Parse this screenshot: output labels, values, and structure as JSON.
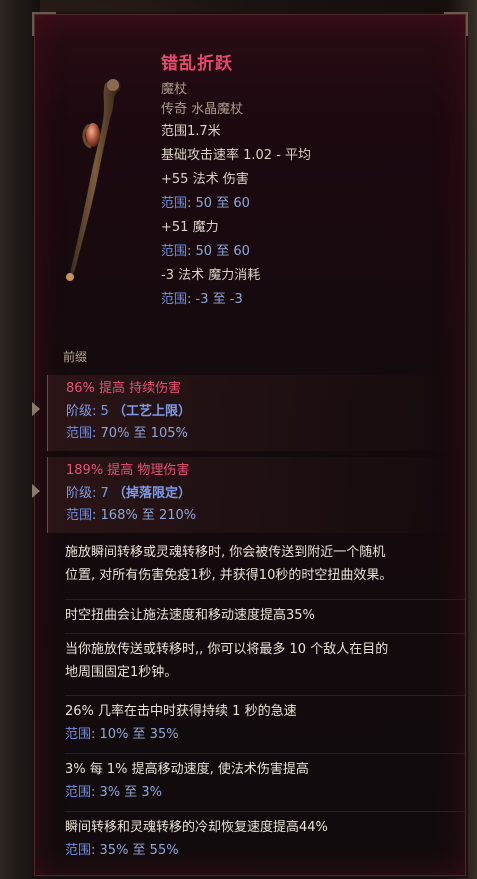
{
  "item": {
    "name": "错乱折跃",
    "base": "魔杖",
    "rarity_type": "传奇 水晶魔杖",
    "range": "范围1.7米",
    "attack_speed": "基础攻击速率 1.02 - 平均",
    "implicits": [
      {
        "text": "+55 法术 伤害",
        "range_label": "范围",
        "range_text": ": 50 至 60"
      },
      {
        "text": "+51 魔力",
        "range_label": "范围",
        "range_text": ": 50 至 60"
      },
      {
        "text": "-3 法术 魔力消耗",
        "range_label": "范围",
        "range_text": ": -3 至 -3"
      }
    ]
  },
  "section_title": "前缀",
  "affixes": [
    {
      "title": "86% 提高 持续伤害",
      "tier_label": "阶级",
      "tier_text": ": 5 ",
      "tier_tag": "（工艺上限）",
      "range_label": "范围",
      "range_text": ": 70% 至 105%"
    },
    {
      "title": "189% 提高 物理伤害",
      "tier_label": "阶级",
      "tier_text": ": 7 ",
      "tier_tag": "（掉落限定）",
      "range_label": "范围",
      "range_text": ": 168% 至 210%"
    }
  ],
  "mods": [
    {
      "text": "施放瞬间转移或灵魂转移时, 你会被传送到附近一个随机",
      "text2": "位置, 对所有伤害免疫1秒, 并获得10秒的时空扭曲效果。"
    },
    {
      "text": "时空扭曲会让施法速度和移动速度提高35%"
    },
    {
      "text": "当你施放传送或转移时,, 你可以将最多 10 个敌人在目的",
      "text2": "地周围固定1秒钟。"
    },
    {
      "text": "26% 几率在击中时获得持续 1 秒的急速",
      "range_label": "范围",
      "range_text": ": 10% 至 35%"
    },
    {
      "text": "3% 每 1% 提高移动速度, 使法术伤害提高",
      "range_label": "范围",
      "range_text": ": 3% 至 3%"
    },
    {
      "text": "瞬间转移和灵魂转移的冷却恢复速度提高44%",
      "range_label": "范围",
      "range_text": ": 35% 至 55%"
    }
  ],
  "colors": {
    "name": "#e8486e",
    "range": "#6f8de0",
    "affix": "#e84e72",
    "text": "#e8e2d8"
  }
}
